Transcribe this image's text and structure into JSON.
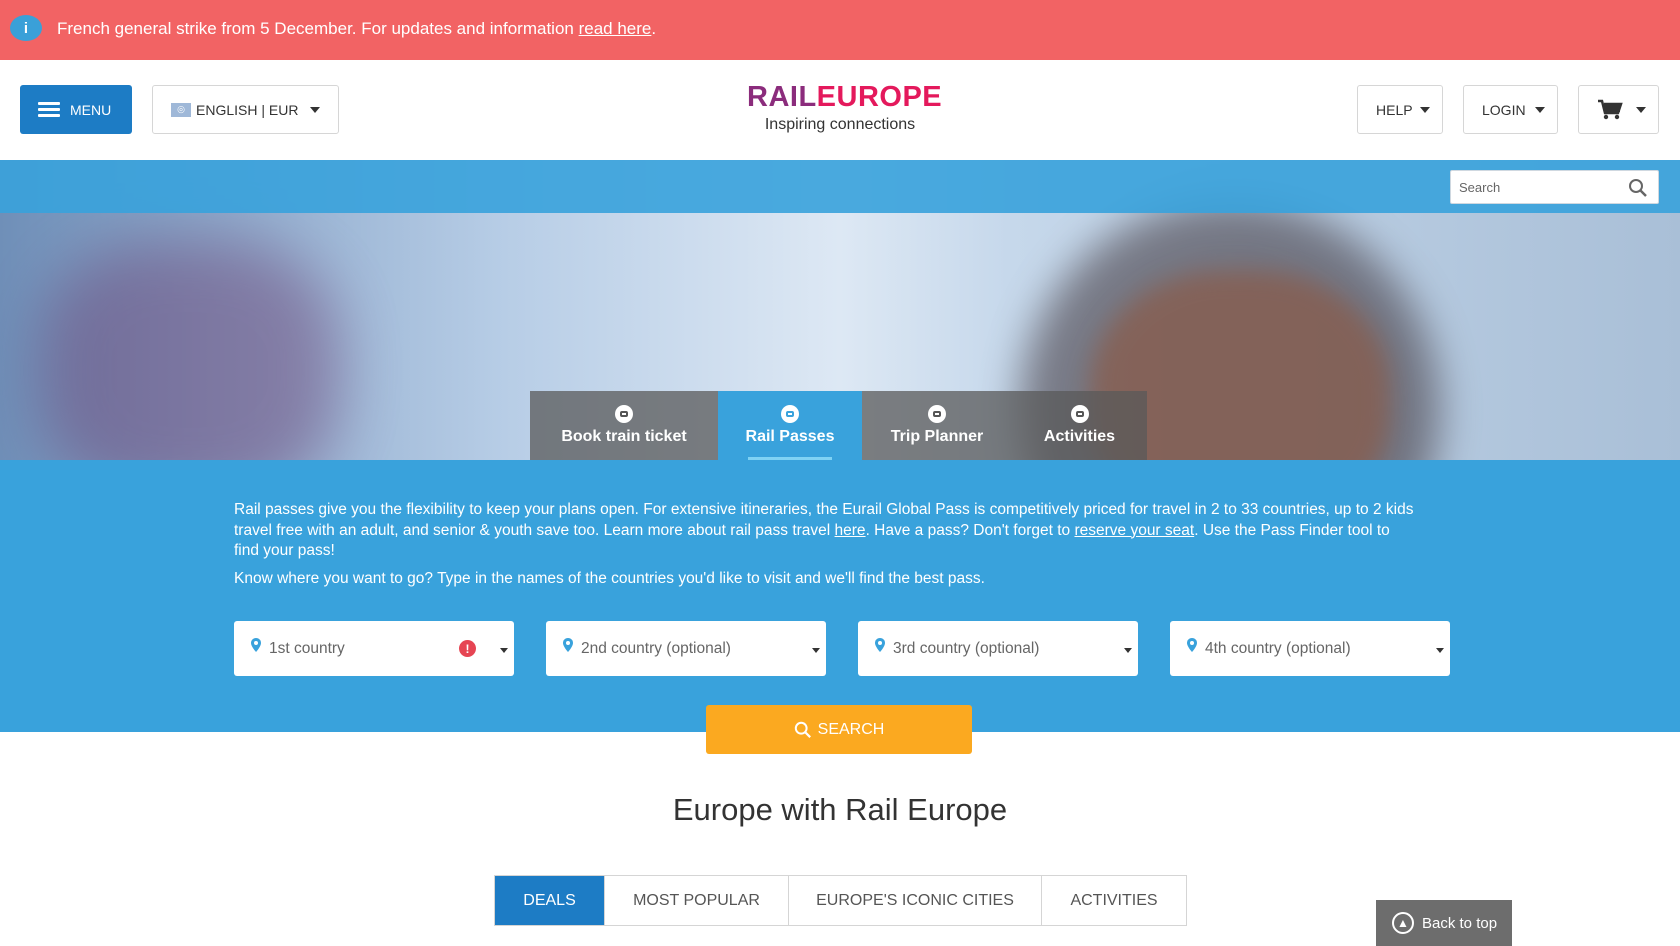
{
  "alert": {
    "message": "French general strike from 5 December. For updates and information ",
    "link": "read here",
    "suffix": "."
  },
  "header": {
    "menu_label": "MENU",
    "language_label": "ENGLISH | EUR",
    "logo": {
      "brand_part1": "RAIL",
      "brand_part2": "EUROPE",
      "tagline": "Inspiring connections"
    },
    "help_label": "HELP",
    "login_label": "LOGIN"
  },
  "search": {
    "placeholder": "Search"
  },
  "tabs": [
    {
      "label": "Book train ticket"
    },
    {
      "label": "Rail Passes"
    },
    {
      "label": "Trip Planner"
    },
    {
      "label": "Activities"
    }
  ],
  "panel": {
    "intro_1": "Rail passes give you the flexibility to keep your plans open. For extensive itineraries, the Eurail Global Pass is competitively priced for travel in 2 to 33 countries, up to 2 kids travel free with an adult, and senior & youth save too. Learn more about rail pass travel ",
    "intro_link1": "here",
    "intro_2": ". Have a pass? Don't forget to ",
    "intro_link2": "reserve your seat",
    "intro_3": ". Use the Pass Finder tool to find your pass!",
    "prompt": "Know where you want to go? Type in the names of the countries you'd like to visit and we'll find the best pass.",
    "fields": [
      {
        "placeholder": "1st country"
      },
      {
        "placeholder": "2nd country (optional)"
      },
      {
        "placeholder": "3rd country (optional)"
      },
      {
        "placeholder": "4th country (optional)"
      }
    ],
    "search_button": "SEARCH"
  },
  "section": {
    "title": "Europe with Rail Europe",
    "subtabs": [
      {
        "label": "DEALS"
      },
      {
        "label": "MOST POPULAR"
      },
      {
        "label": "EUROPE'S ICONIC CITIES"
      },
      {
        "label": "ACTIVITIES"
      }
    ]
  },
  "back_to_top": "Back to top",
  "colors": {
    "alert": "#f26364",
    "primary": "#1d7cc5",
    "panel": "#39a2dc",
    "search_button": "#fba920"
  }
}
